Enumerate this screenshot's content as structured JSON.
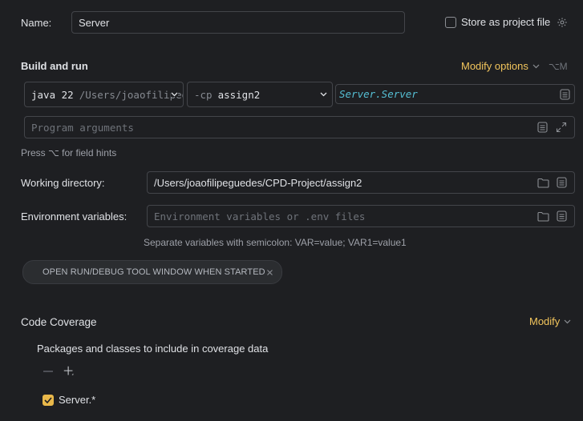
{
  "name": {
    "label": "Name:",
    "value": "Server"
  },
  "store_project_file": {
    "label": "Store as project file",
    "checked": false
  },
  "build_run": {
    "title": "Build and run",
    "modify_options_label": "Modify options",
    "shortcut": "⌥M",
    "jdk": {
      "version": "java 22",
      "path": "/Users/joaofilipeguedes"
    },
    "classpath": {
      "prefix": "-cp",
      "module": "assign2"
    },
    "main_class": "Server.Server",
    "program_args_placeholder": "Program arguments",
    "field_hint": "Press ⌥ for field hints"
  },
  "working_directory": {
    "label": "Working directory:",
    "value": "/Users/joaofilipeguedes/CPD-Project/assign2"
  },
  "env_vars": {
    "label": "Environment variables:",
    "placeholder": "Environment variables or .env files",
    "hint": "Separate variables with semicolon: VAR=value; VAR1=value1"
  },
  "tool_window_chip": {
    "label": "OPEN RUN/DEBUG TOOL WINDOW WHEN STARTED"
  },
  "code_coverage": {
    "title": "Code Coverage",
    "modify_label": "Modify",
    "packages_label": "Packages and classes to include in coverage data",
    "entries": [
      {
        "pattern": "Server.*",
        "checked": true
      }
    ]
  },
  "colors": {
    "accent": "#f2c55c",
    "main_class": "#56c1d6",
    "checkbox_checked": "#e9b84a"
  }
}
